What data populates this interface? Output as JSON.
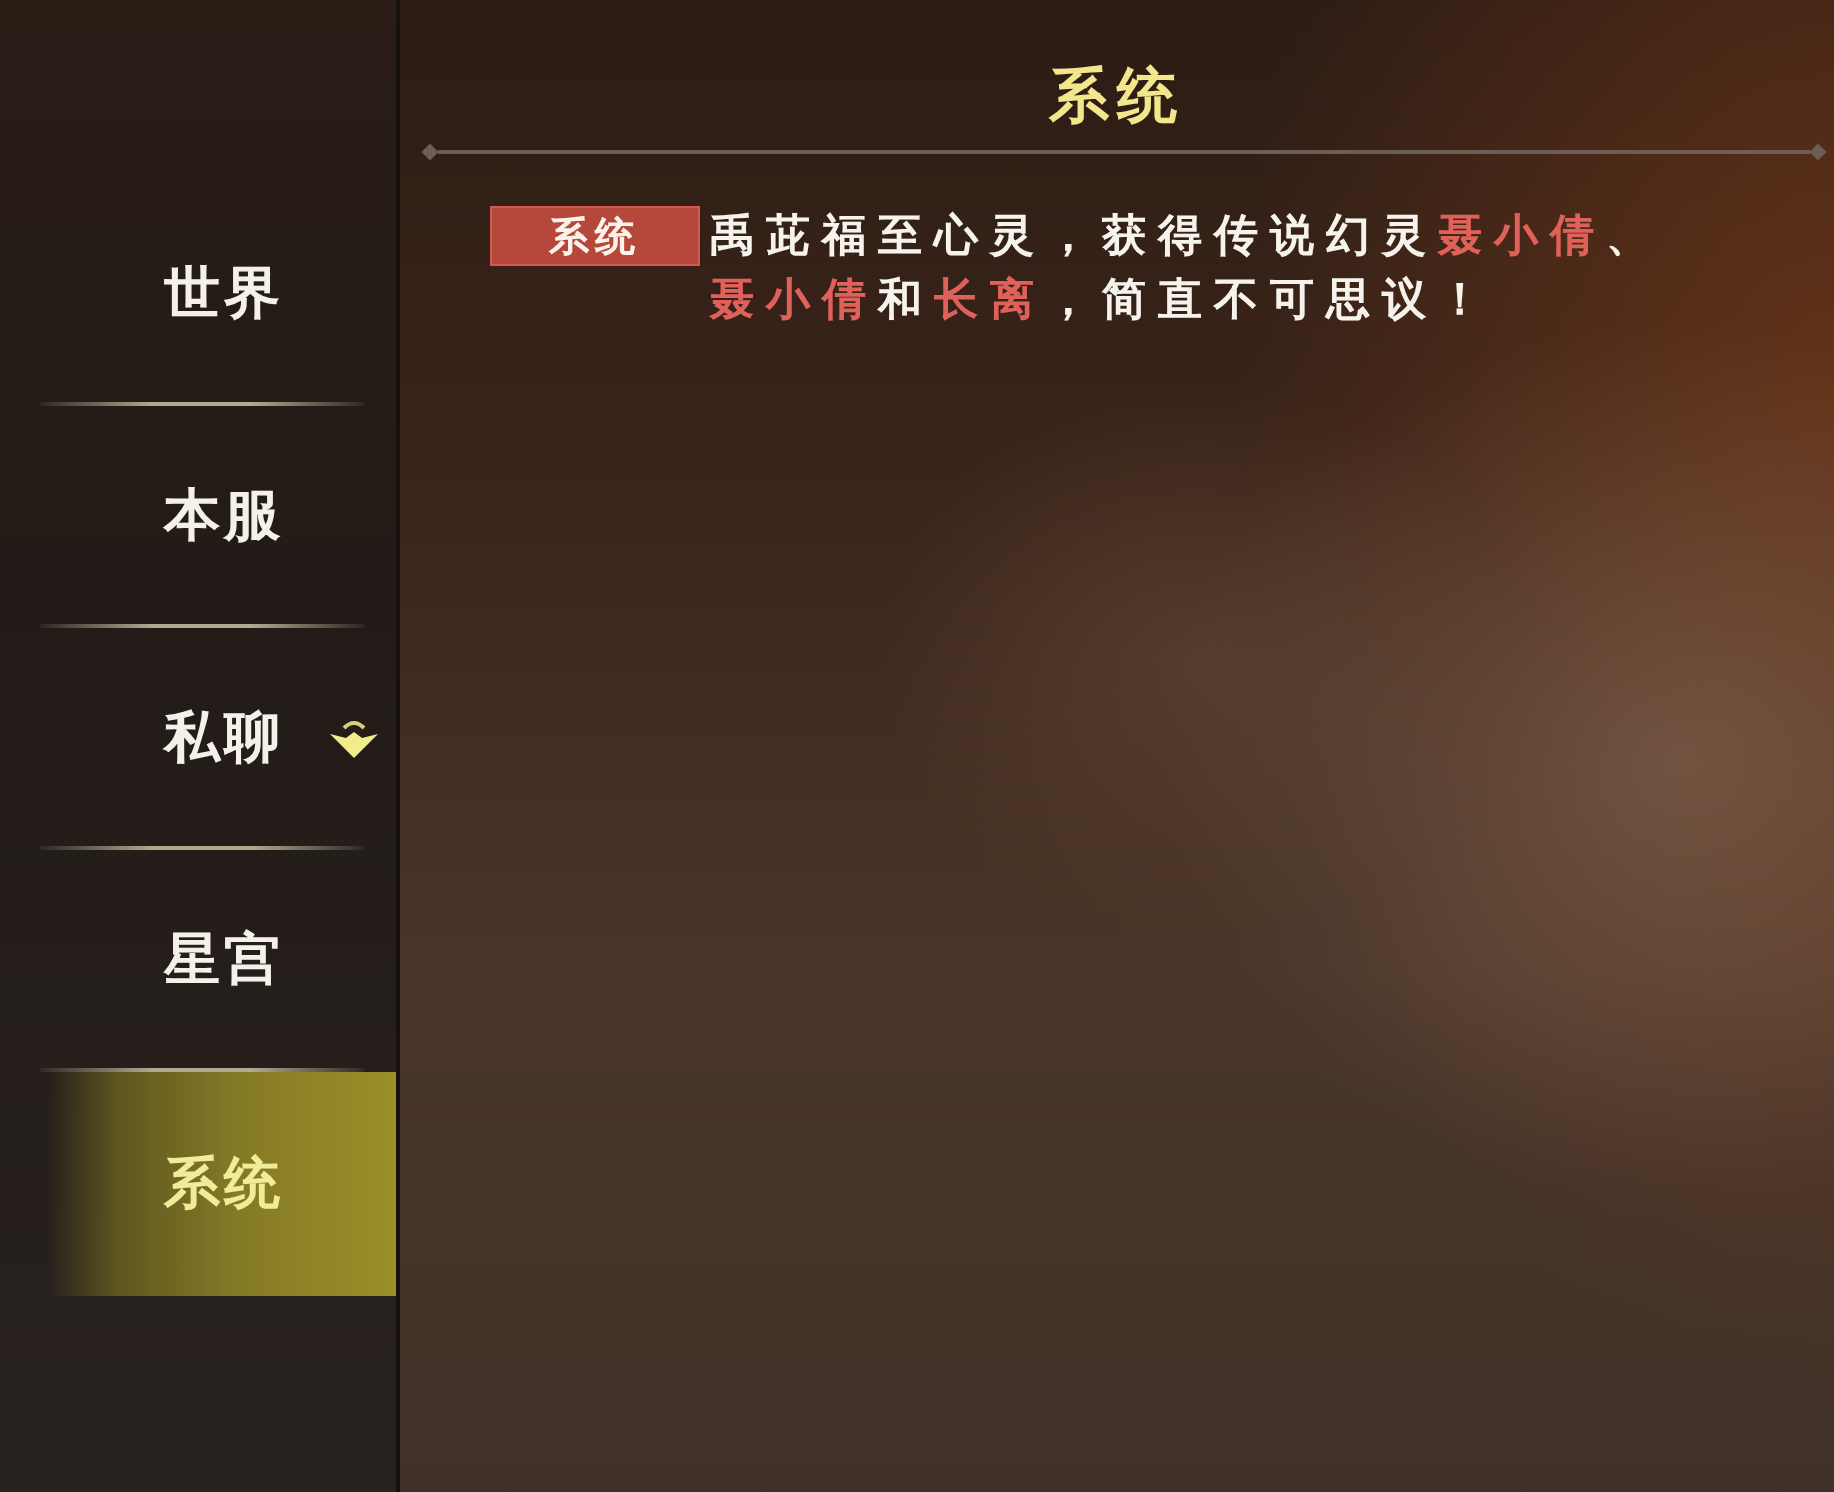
{
  "sidebar": {
    "items": [
      {
        "label": "世界",
        "selected": false,
        "indicator": false
      },
      {
        "label": "本服",
        "selected": false,
        "indicator": false
      },
      {
        "label": "私聊",
        "selected": false,
        "indicator": true
      },
      {
        "label": "星宫",
        "selected": false,
        "indicator": false
      },
      {
        "label": "系统",
        "selected": true,
        "indicator": false
      }
    ]
  },
  "panel": {
    "title": "系统"
  },
  "messages": [
    {
      "channel": "系统",
      "segments": [
        {
          "kind": "text",
          "text": "禹茈福至心灵，获得传说幻灵"
        },
        {
          "kind": "name",
          "text": "聂小倩"
        },
        {
          "kind": "text",
          "text": "、"
        },
        {
          "kind": "name",
          "text": "聂小倩"
        },
        {
          "kind": "text",
          "text": "和"
        },
        {
          "kind": "name",
          "text": "长离"
        },
        {
          "kind": "text",
          "text": "，简直不可思议！"
        }
      ]
    }
  ]
}
